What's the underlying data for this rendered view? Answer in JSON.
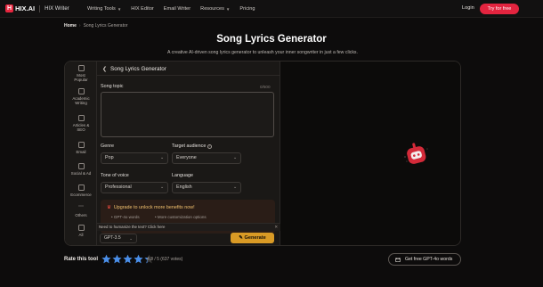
{
  "nav": {
    "logo_mark": "H",
    "brand": "HIX.AI",
    "product": "HIX Writer",
    "links": [
      {
        "label": "Writing Tools",
        "dropdown": true
      },
      {
        "label": "HIX Editor",
        "dropdown": false
      },
      {
        "label": "Email Writer",
        "dropdown": false
      },
      {
        "label": "Resources",
        "dropdown": true
      },
      {
        "label": "Pricing",
        "dropdown": false
      }
    ],
    "login": "Login",
    "cta": "Try for free"
  },
  "breadcrumb": {
    "home": "Home",
    "current": "Song Lyrics Generator"
  },
  "page": {
    "title": "Song Lyrics Generator",
    "subtitle": "A creative AI-driven song lyrics generator to unleash your inner songwriter in just a few clicks."
  },
  "sidebar": {
    "items": [
      {
        "label1": "Most",
        "label2": "Popular",
        "icon": "star-box-icon"
      },
      {
        "label1": "Academic",
        "label2": "Writing",
        "icon": "cap-icon"
      },
      {
        "label1": "Articles &",
        "label2": "SEO",
        "icon": "article-icon"
      },
      {
        "label1": "Email",
        "label2": "",
        "icon": "mail-icon"
      },
      {
        "label1": "Social & Ad",
        "label2": "",
        "icon": "social-icon"
      },
      {
        "label1": "Ecommerce",
        "label2": "",
        "icon": "cart-icon"
      },
      {
        "label1": "Others",
        "label2": "",
        "icon": "dots-icon"
      },
      {
        "label1": "All",
        "label2": "",
        "icon": "grid-icon"
      }
    ]
  },
  "form": {
    "header": "Song Lyrics Generator",
    "topic_label": "Song topic",
    "topic_counter": "0/500",
    "topic_value": "",
    "genre_label": "Genre",
    "genre_value": "Pop",
    "audience_label": "Target audience",
    "audience_value": "Everyone",
    "tone_label": "Tone of voice",
    "tone_value": "Professional",
    "language_label": "Language",
    "language_value": "English"
  },
  "upgrade": {
    "title": "Upgrade to unlock more benefits now!",
    "feature1": "GPT-4o words",
    "feature2": "More customization options"
  },
  "humanize": {
    "text": "Need to humanize the text? Click here"
  },
  "footer_bar": {
    "model": "GPT-3.5",
    "generate": "Generate"
  },
  "rating": {
    "label": "Rate this tool",
    "value": 4.3,
    "max": 5,
    "text": "4.3 / 5 (637 votes)"
  },
  "free_btn": {
    "label": "Get free GPT-4o words"
  },
  "colors": {
    "accent": "#e3243f",
    "generate": "#d99a25",
    "star": "#4a8ee8"
  }
}
